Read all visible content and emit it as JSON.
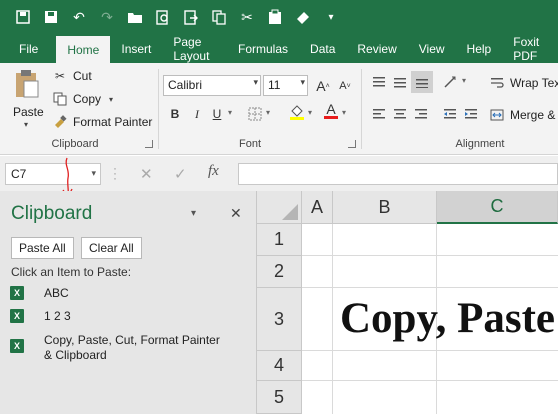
{
  "quick_access_icons": [
    "save-icon",
    "save-as-icon",
    "undo-icon",
    "redo-icon",
    "open-icon",
    "print-preview-icon",
    "export-icon",
    "copy-icon",
    "cut-icon",
    "clipboard-icon",
    "format-painter-icon"
  ],
  "tabs": [
    {
      "label": "File"
    },
    {
      "label": "Home",
      "active": true
    },
    {
      "label": "Insert"
    },
    {
      "label": "Page Layout"
    },
    {
      "label": "Formulas"
    },
    {
      "label": "Data"
    },
    {
      "label": "Review"
    },
    {
      "label": "View"
    },
    {
      "label": "Help"
    },
    {
      "label": "Foxit PDF"
    }
  ],
  "ribbon": {
    "clipboard": {
      "paste_label": "Paste",
      "cut_label": "Cut",
      "copy_label": "Copy",
      "format_painter_label": "Format Painter",
      "group_label": "Clipboard"
    },
    "font": {
      "font_name": "Calibri",
      "font_size": "11",
      "group_label": "Font",
      "bold": "B",
      "italic": "I",
      "underline": "U",
      "grow": "A",
      "shrink": "A",
      "font_color": "A"
    },
    "alignment": {
      "wrap_text_label": "Wrap Tex",
      "merge_label": "Merge &",
      "group_label": "Alignment"
    }
  },
  "formula_bar": {
    "name_box": "C7",
    "fx_label": "fx",
    "formula": ""
  },
  "clipboard_pane": {
    "title": "Clipboard",
    "paste_all_label": "Paste All",
    "clear_all_label": "Clear All",
    "instruction": "Click an Item to Paste:",
    "items": [
      {
        "text": "ABC"
      },
      {
        "text": "1 2 3"
      },
      {
        "text_line1": "Copy, Paste, Cut, Format Painter",
        "text_line2": "& Clipboard"
      }
    ]
  },
  "sheet": {
    "columns": [
      "A",
      "B",
      "C"
    ],
    "rows": [
      "1",
      "2",
      "3",
      "4",
      "5"
    ],
    "selected_column": "C",
    "cell_text": "Copy, Paste"
  },
  "colors": {
    "accent": "#217346",
    "annotation": "#e02020"
  }
}
